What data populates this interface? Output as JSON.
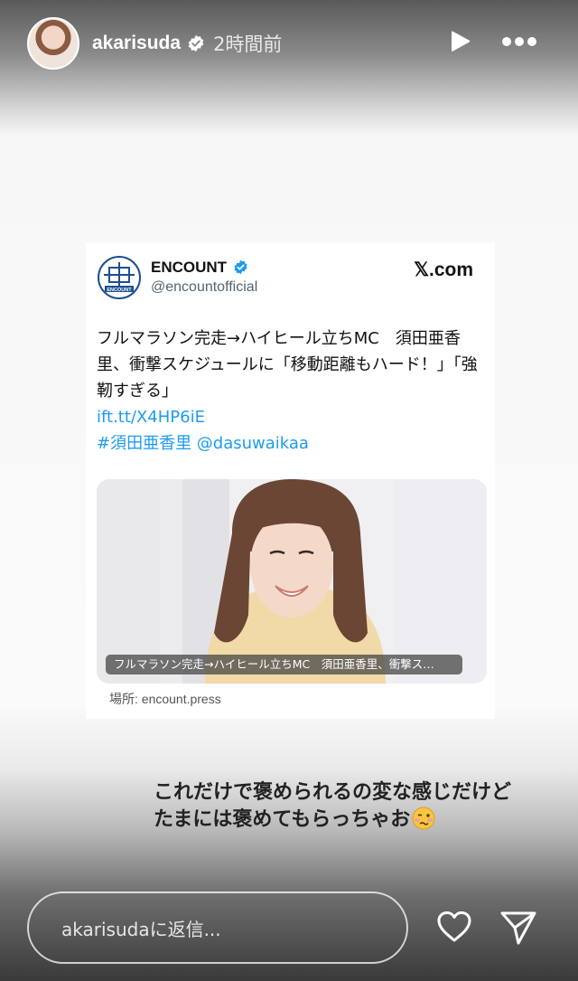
{
  "header": {
    "username": "akarisuda",
    "time": "2時間前",
    "verified_icon": "verified-icon",
    "play_icon": "play-icon",
    "more_icon": "more-icon"
  },
  "card": {
    "account_name": "ENCOUNT",
    "handle": "@encountofficial",
    "logo_text": "ENCOUNT",
    "site": "𝕏.com",
    "body_text": "フルマラソン完走→ハイヒール立ちMC　須田亜香里、衝撃スケジュールに「移動距離もハード！」「強靭すぎる」",
    "link": "ift.tt/X4HP6iE",
    "tags": "#須田亜香里 @dasuwaikaa",
    "image_caption": "フルマラソン完走→ハイヒール立ちMC　須田亜香里、衝撃ス…",
    "source": "場所: encount.press"
  },
  "story_text": {
    "line1": "これだけで褒められるの変な感じだけど",
    "line2": "たまには褒めてもらっちゃお",
    "emoji": "woozy-face-emoji"
  },
  "reply": {
    "placeholder": "akarisudaに返信..."
  },
  "colors": {
    "link_blue": "#1d9bf0",
    "verified_blue": "#1d9bf0"
  }
}
